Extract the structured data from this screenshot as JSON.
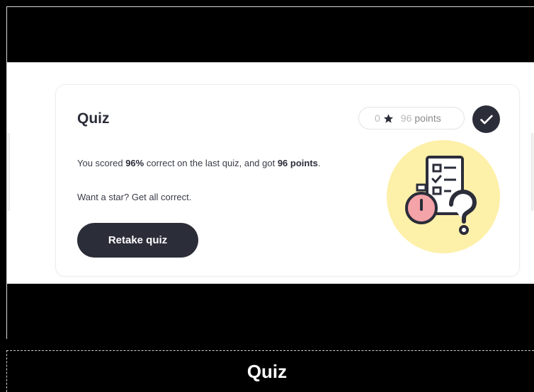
{
  "card": {
    "title": "Quiz",
    "stars_count": "0",
    "points_value": "96",
    "points_label": "points",
    "score_prefix": "You scored ",
    "score_percent": "96%",
    "score_middle": " correct on the last quiz, and got ",
    "score_points": "96 points",
    "score_suffix": ".",
    "hint": "Want a star? Get all correct.",
    "retake_label": "Retake quiz",
    "completed": true
  },
  "footer": {
    "title": "Quiz"
  },
  "icons": [
    "star-icon",
    "check-icon",
    "quiz-illustration"
  ],
  "colors": {
    "primary_dark": "#2b2d39",
    "illustration_bg": "#fdf0a8",
    "stopwatch_fill": "#f4a3a8",
    "background": "#000000",
    "card_bg": "#ffffff"
  }
}
